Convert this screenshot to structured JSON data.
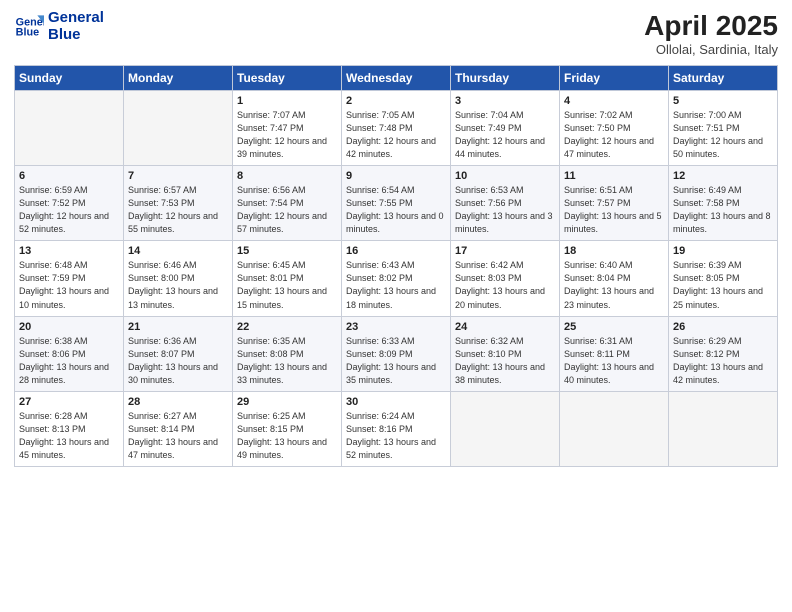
{
  "header": {
    "logo_line1": "General",
    "logo_line2": "Blue",
    "month": "April 2025",
    "location": "Ollolai, Sardinia, Italy"
  },
  "weekdays": [
    "Sunday",
    "Monday",
    "Tuesday",
    "Wednesday",
    "Thursday",
    "Friday",
    "Saturday"
  ],
  "weeks": [
    [
      {
        "day": "",
        "info": ""
      },
      {
        "day": "",
        "info": ""
      },
      {
        "day": "1",
        "info": "Sunrise: 7:07 AM\nSunset: 7:47 PM\nDaylight: 12 hours and 39 minutes."
      },
      {
        "day": "2",
        "info": "Sunrise: 7:05 AM\nSunset: 7:48 PM\nDaylight: 12 hours and 42 minutes."
      },
      {
        "day": "3",
        "info": "Sunrise: 7:04 AM\nSunset: 7:49 PM\nDaylight: 12 hours and 44 minutes."
      },
      {
        "day": "4",
        "info": "Sunrise: 7:02 AM\nSunset: 7:50 PM\nDaylight: 12 hours and 47 minutes."
      },
      {
        "day": "5",
        "info": "Sunrise: 7:00 AM\nSunset: 7:51 PM\nDaylight: 12 hours and 50 minutes."
      }
    ],
    [
      {
        "day": "6",
        "info": "Sunrise: 6:59 AM\nSunset: 7:52 PM\nDaylight: 12 hours and 52 minutes."
      },
      {
        "day": "7",
        "info": "Sunrise: 6:57 AM\nSunset: 7:53 PM\nDaylight: 12 hours and 55 minutes."
      },
      {
        "day": "8",
        "info": "Sunrise: 6:56 AM\nSunset: 7:54 PM\nDaylight: 12 hours and 57 minutes."
      },
      {
        "day": "9",
        "info": "Sunrise: 6:54 AM\nSunset: 7:55 PM\nDaylight: 13 hours and 0 minutes."
      },
      {
        "day": "10",
        "info": "Sunrise: 6:53 AM\nSunset: 7:56 PM\nDaylight: 13 hours and 3 minutes."
      },
      {
        "day": "11",
        "info": "Sunrise: 6:51 AM\nSunset: 7:57 PM\nDaylight: 13 hours and 5 minutes."
      },
      {
        "day": "12",
        "info": "Sunrise: 6:49 AM\nSunset: 7:58 PM\nDaylight: 13 hours and 8 minutes."
      }
    ],
    [
      {
        "day": "13",
        "info": "Sunrise: 6:48 AM\nSunset: 7:59 PM\nDaylight: 13 hours and 10 minutes."
      },
      {
        "day": "14",
        "info": "Sunrise: 6:46 AM\nSunset: 8:00 PM\nDaylight: 13 hours and 13 minutes."
      },
      {
        "day": "15",
        "info": "Sunrise: 6:45 AM\nSunset: 8:01 PM\nDaylight: 13 hours and 15 minutes."
      },
      {
        "day": "16",
        "info": "Sunrise: 6:43 AM\nSunset: 8:02 PM\nDaylight: 13 hours and 18 minutes."
      },
      {
        "day": "17",
        "info": "Sunrise: 6:42 AM\nSunset: 8:03 PM\nDaylight: 13 hours and 20 minutes."
      },
      {
        "day": "18",
        "info": "Sunrise: 6:40 AM\nSunset: 8:04 PM\nDaylight: 13 hours and 23 minutes."
      },
      {
        "day": "19",
        "info": "Sunrise: 6:39 AM\nSunset: 8:05 PM\nDaylight: 13 hours and 25 minutes."
      }
    ],
    [
      {
        "day": "20",
        "info": "Sunrise: 6:38 AM\nSunset: 8:06 PM\nDaylight: 13 hours and 28 minutes."
      },
      {
        "day": "21",
        "info": "Sunrise: 6:36 AM\nSunset: 8:07 PM\nDaylight: 13 hours and 30 minutes."
      },
      {
        "day": "22",
        "info": "Sunrise: 6:35 AM\nSunset: 8:08 PM\nDaylight: 13 hours and 33 minutes."
      },
      {
        "day": "23",
        "info": "Sunrise: 6:33 AM\nSunset: 8:09 PM\nDaylight: 13 hours and 35 minutes."
      },
      {
        "day": "24",
        "info": "Sunrise: 6:32 AM\nSunset: 8:10 PM\nDaylight: 13 hours and 38 minutes."
      },
      {
        "day": "25",
        "info": "Sunrise: 6:31 AM\nSunset: 8:11 PM\nDaylight: 13 hours and 40 minutes."
      },
      {
        "day": "26",
        "info": "Sunrise: 6:29 AM\nSunset: 8:12 PM\nDaylight: 13 hours and 42 minutes."
      }
    ],
    [
      {
        "day": "27",
        "info": "Sunrise: 6:28 AM\nSunset: 8:13 PM\nDaylight: 13 hours and 45 minutes."
      },
      {
        "day": "28",
        "info": "Sunrise: 6:27 AM\nSunset: 8:14 PM\nDaylight: 13 hours and 47 minutes."
      },
      {
        "day": "29",
        "info": "Sunrise: 6:25 AM\nSunset: 8:15 PM\nDaylight: 13 hours and 49 minutes."
      },
      {
        "day": "30",
        "info": "Sunrise: 6:24 AM\nSunset: 8:16 PM\nDaylight: 13 hours and 52 minutes."
      },
      {
        "day": "",
        "info": ""
      },
      {
        "day": "",
        "info": ""
      },
      {
        "day": "",
        "info": ""
      }
    ]
  ]
}
